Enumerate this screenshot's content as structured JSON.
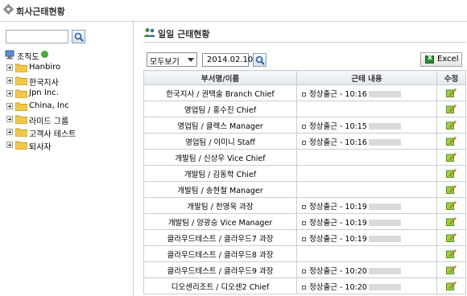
{
  "header": {
    "title": "회사근태현황"
  },
  "tree": {
    "root_label": "조직도",
    "nodes": [
      "Hanbiro",
      "한국지사",
      "Jpn Inc.",
      "China, Inc",
      "라미드 그룹",
      "고객사 테스트",
      "퇴사자"
    ]
  },
  "main": {
    "section_title": "일일 근태현황",
    "filter_value": "모두보기",
    "date_value": "2014.02.10",
    "excel_label": "Excel",
    "columns": {
      "name": "부서명/이름",
      "content": "근태 내용",
      "edit": "수정"
    },
    "rows": [
      {
        "name": "한국지사 / 권택술 Branch Chief",
        "status": "정상출근 - 10:16"
      },
      {
        "name": "영업팀 / 홍수진 Chief",
        "status": ""
      },
      {
        "name": "영업팀 / 클렉스 Manager",
        "status": "정상출근 - 10:15"
      },
      {
        "name": "영업팀 / 이미니 Staff",
        "status": "정상출근 - 10:16"
      },
      {
        "name": "개발팀 / 신상우 Vice Chief",
        "status": ""
      },
      {
        "name": "개발팀 / 김동학 Chief",
        "status": ""
      },
      {
        "name": "개발팀 / 송현철 Manager",
        "status": ""
      },
      {
        "name": "개발팀 / 천영욱 과장",
        "status": "정상출근 - 10:19"
      },
      {
        "name": "개발팀 / 양광승 Vice Manager",
        "status": "정상출근 - 10:19"
      },
      {
        "name": "클라우드테스트 / 클라우드7 과장",
        "status": "정상출근 - 10:19"
      },
      {
        "name": "클라우드테스트 / 클라우드8 과장",
        "status": ""
      },
      {
        "name": "클라우드테스트 / 클라우드9 과장",
        "status": "정상출근 - 10:20"
      },
      {
        "name": "디오센리조트 / 디오센2 Chief",
        "status": "정상출근 - 10:20"
      }
    ]
  },
  "colors": {
    "accent": "#4caa3a",
    "folder": "#f2c84b",
    "edit_icon": "#7dbb2e"
  }
}
